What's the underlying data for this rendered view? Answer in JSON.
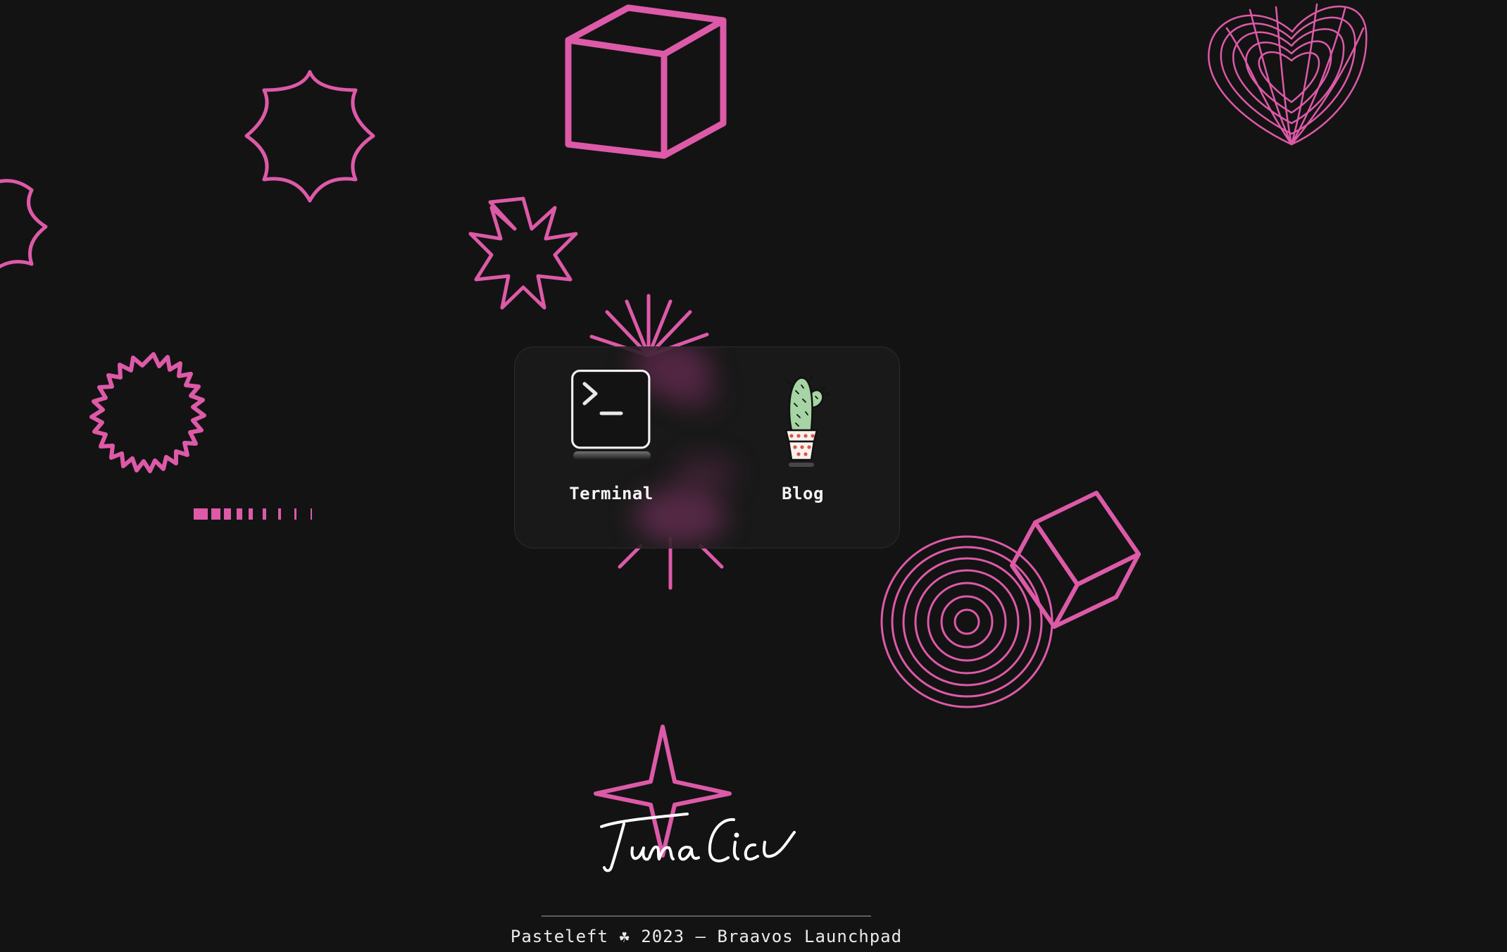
{
  "apps": [
    {
      "label": "Terminal",
      "icon": "terminal-icon"
    },
    {
      "label": "Blog",
      "icon": "cactus-icon"
    }
  ],
  "signature": {
    "text": "Tuna Cici"
  },
  "footer": {
    "text": "Pasteleft ☘ 2023 – Braavos Launchpad"
  },
  "colors": {
    "background": "#131313",
    "accent": "#dd5aa8",
    "panel": "#1a1a1a",
    "text": "#f4f4f4"
  }
}
